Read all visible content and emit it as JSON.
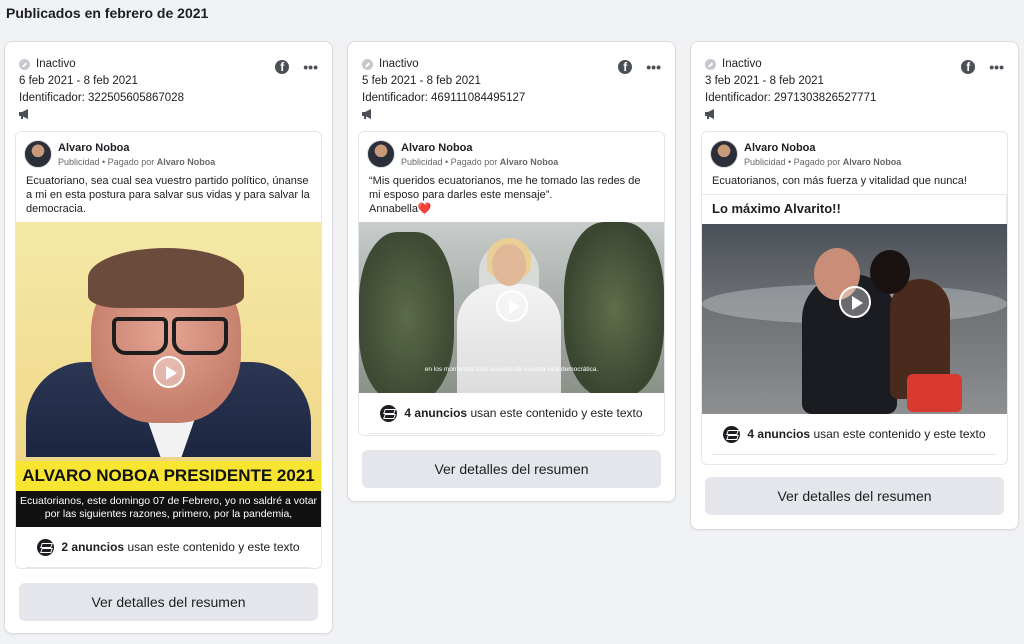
{
  "page": {
    "title": "Publicados en febrero de 2021"
  },
  "cards": [
    {
      "status": "Inactivo",
      "dates": "6 feb 2021 - 8 feb 2021",
      "identifier": "Identificador: 322505605867028",
      "advertiser": "Alvaro Noboa",
      "sub_prefix": "Publicidad • Pagado por",
      "sub_payer": "Alvaro Noboa",
      "text": "Ecuatoriano, sea cual sea vuestro partido político, únanse a mi en esta postura para salvar sus vidas y para salvar la democracia.",
      "banner": "ALVARO NOBOA PRESIDENTE 2021",
      "caption": "Ecuatorianos, este domingo 07 de Febrero, yo no saldré a votar por las siguientes razones, primero, por la pandemia,",
      "usage_count": "2 anuncios",
      "usage_rest": "usan este contenido y este texto",
      "button": "Ver detalles del resumen"
    },
    {
      "status": "Inactivo",
      "dates": "5 feb 2021 - 8 feb 2021",
      "identifier": "Identificador: 469111084495127",
      "advertiser": "Alvaro Noboa",
      "sub_prefix": "Publicidad • Pagado por",
      "sub_payer": "Alvaro Noboa",
      "text": "“Mis queridos ecuatorianos, me he tomado las redes de mi esposo para darles este mensaje”.\nAnnabella❤️",
      "subtitle": "en los momentos más oscuros de nuestra vida democrática.",
      "usage_count": "4 anuncios",
      "usage_rest": "usan este contenido y este texto",
      "button": "Ver detalles del resumen"
    },
    {
      "status": "Inactivo",
      "dates": "3 feb 2021 - 8 feb 2021",
      "identifier": "Identificador: 2971303826527771",
      "advertiser": "Alvaro Noboa",
      "sub_prefix": "Publicidad • Pagado por",
      "sub_payer": "Alvaro Noboa",
      "text": "Ecuatorianos, con más fuerza y vitalidad que nunca!",
      "headline": "Lo máximo Alvarito!!",
      "usage_count": "4 anuncios",
      "usage_rest": "usan este contenido y este texto",
      "button": "Ver detalles del resumen"
    }
  ],
  "icons": {
    "status": "inactive-status-icon",
    "facebook": "facebook-icon",
    "more": "more-options-icon",
    "megaphone": "megaphone-icon",
    "stack": "stack-icon",
    "play": "play-icon"
  }
}
